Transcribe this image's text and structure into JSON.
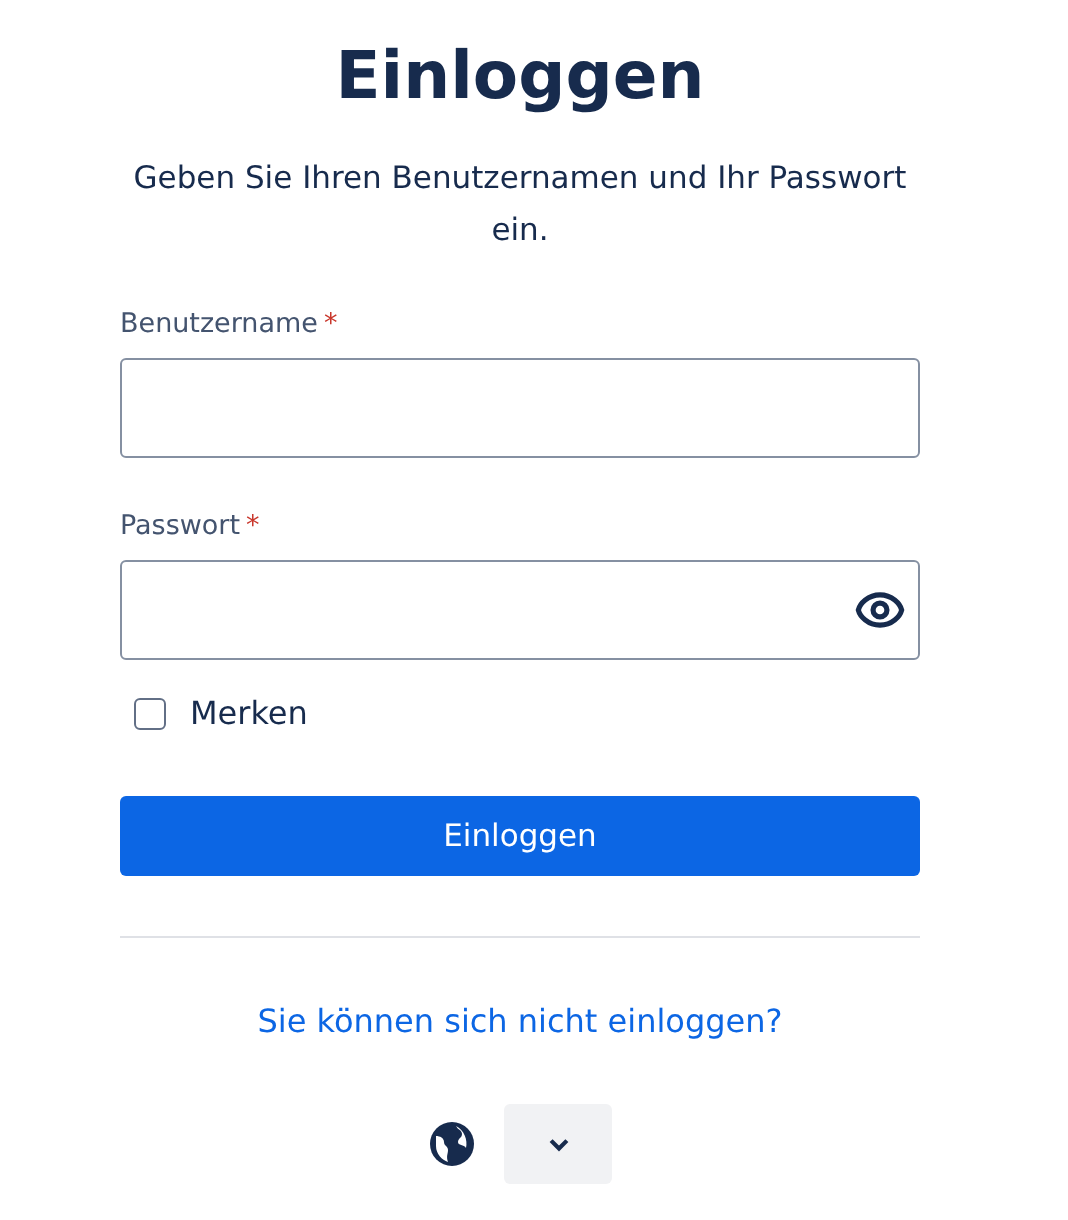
{
  "title": "Einloggen",
  "subtitle": "Geben Sie Ihren Benutzernamen und Ihr Passwort ein.",
  "fields": [
    {
      "kind": "text",
      "label": "Benutzername",
      "required_mark": "*"
    },
    {
      "kind": "password",
      "label": "Passwort",
      "required_mark": "*"
    }
  ],
  "remember": {
    "label": "Merken",
    "checked": false
  },
  "submit": "Einloggen",
  "help_link": "Sie können sich nicht einloggen?"
}
